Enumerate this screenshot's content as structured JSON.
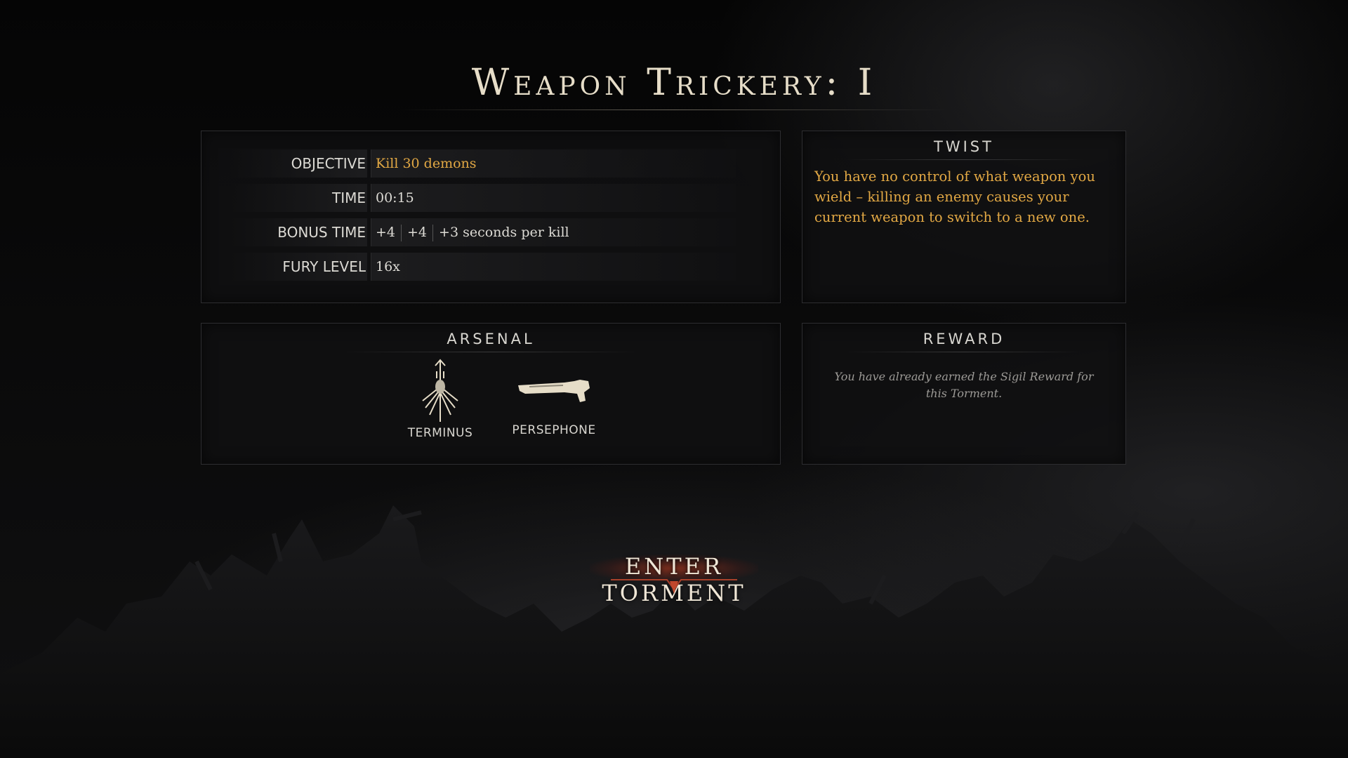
{
  "title": "Weapon Trickery: I",
  "info": {
    "objective_label": "OBJECTIVE",
    "objective_value": "Kill 30 demons",
    "time_label": "TIME",
    "time_value": "00:15",
    "bonus_label": "BONUS TIME",
    "bonus_values": [
      "+4",
      "+4",
      "+3 seconds per kill"
    ],
    "fury_label": "FURY LEVEL",
    "fury_value": "16x"
  },
  "twist": {
    "header": "TWIST",
    "text": "You have no control of what weapon you wield – killing an enemy causes your current weapon to switch to a new one."
  },
  "arsenal": {
    "header": "ARSENAL",
    "weapons": [
      {
        "name": "TERMINUS",
        "icon": "trident-icon"
      },
      {
        "name": "PERSEPHONE",
        "icon": "shotgun-icon"
      }
    ]
  },
  "reward": {
    "header": "REWARD",
    "text": "You have already earned the Sigil Reward for this Torment."
  },
  "enter_button": "ENTER TORMENT",
  "colors": {
    "accent_gold": "#e2a844",
    "title": "#e6ddc8",
    "button_glow": "#c83c1e"
  }
}
